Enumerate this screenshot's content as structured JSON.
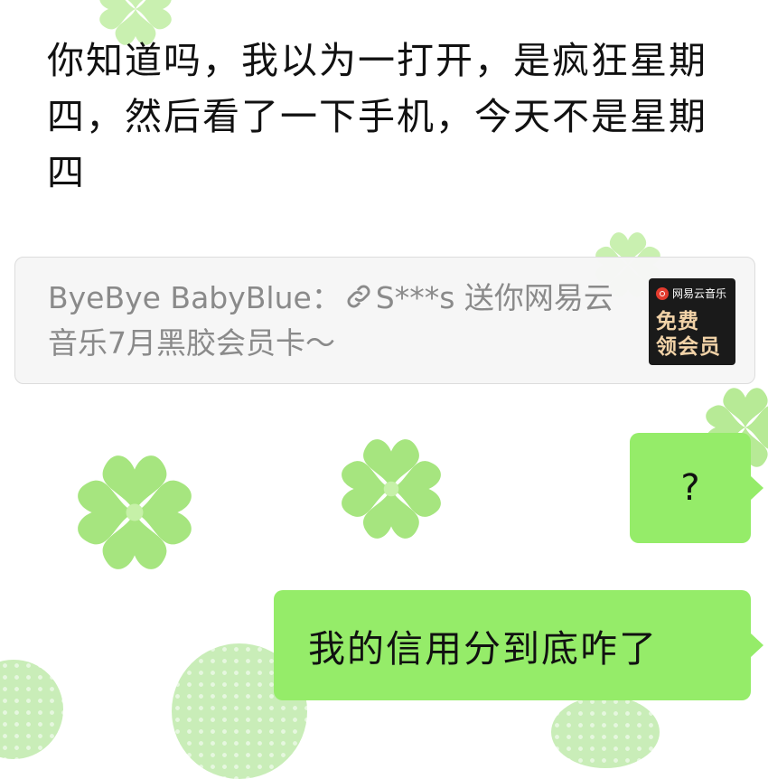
{
  "wallpaper": {
    "clover_color": "#a6e57f",
    "clover_center": "#c6f1a8"
  },
  "messages": {
    "incoming_text": "你知道吗，我以为一打开，是疯狂星期四，然后看了一下手机，今天不是星期四",
    "share_card": {
      "sender": "ByeBye BabyBlue：",
      "link_icon": "link-icon",
      "text": "S***s 送你网易云音乐7月黑胶会员卡～",
      "thumbnail": {
        "brand": "网易云音乐",
        "line1": "免费",
        "line2": "领会员",
        "background": "#1a1a1a",
        "accent": "#e33b2e",
        "text_color": "#f2d3a8"
      }
    },
    "outgoing": [
      {
        "text": "?"
      },
      {
        "text": "我的信用分到底咋了"
      }
    ],
    "outgoing_bubble_color": "#95ec69"
  }
}
